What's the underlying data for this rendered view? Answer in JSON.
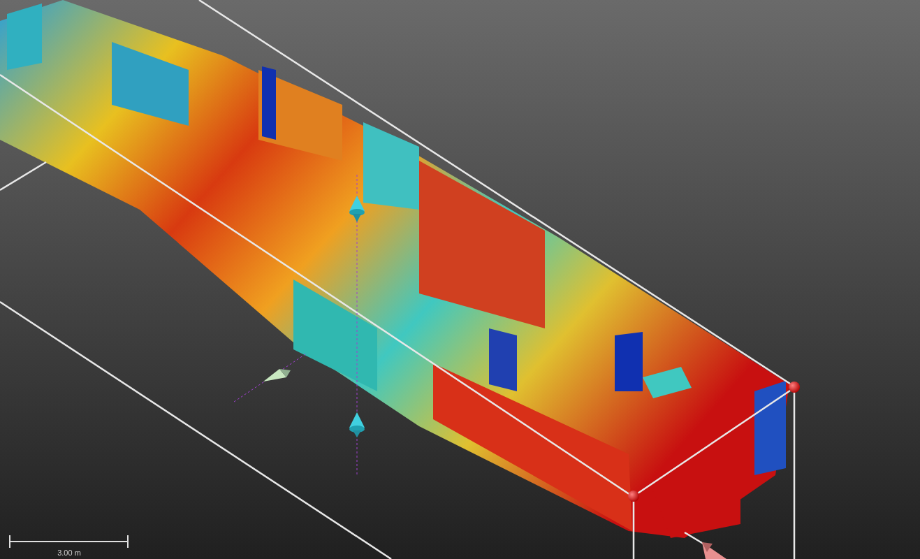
{
  "scale_bar": {
    "label": "3.00 m"
  }
}
